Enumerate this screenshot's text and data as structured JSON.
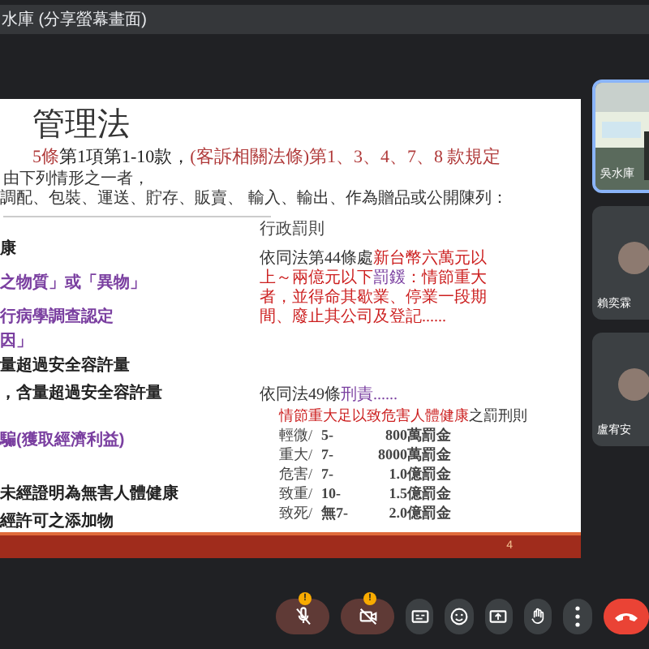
{
  "share_banner": {
    "title": "水庫 (分享螢幕畫面)"
  },
  "slide": {
    "title": "管理法",
    "subtitle": [
      {
        "text": "5條",
        "color": "#b03a3a"
      },
      {
        "text": "第1項第1-10款，",
        "color": "#222222"
      },
      {
        "text": "(客訴相關法條)第1、3、4、7、8 款規定",
        "color": "#b03a3a"
      }
    ],
    "intro_lines": [
      "由下列情形之一者，",
      "調配、包裝、運送、貯存、販賣、 輸入、輸出、作為贈品或公開陳列："
    ],
    "left_items": [
      {
        "text": "康",
        "color": "#222222"
      },
      {
        "text": "之物質」或「異物」",
        "color": "#7a3fa0"
      },
      {
        "text": "行病學調查認定",
        "color": "#7a3fa0"
      },
      {
        "text": "因」",
        "color": "#7a3fa0"
      },
      {
        "text": "量超過安全容許量",
        "color": "#222222"
      },
      {
        "text": "，含量超過安全容許量",
        "color": "#222222"
      },
      {
        "text": "騙(獲取經濟利益)",
        "color": "#7a3fa0"
      },
      {
        "text": "未經證明為無害人體健康",
        "color": "#222222"
      },
      {
        "text": "經許可之添加物",
        "color": "#222222"
      }
    ],
    "admin_heading": "行政罰則",
    "admin_text": [
      {
        "text": "依同法第44條處",
        "color": "#333333"
      },
      {
        "text": "新台幣六萬元以上～兩億元以下",
        "color": "#cc1f1f"
      },
      {
        "text": "罰鍰",
        "color": "#7a3fa0"
      },
      {
        "text": "：情節重大者，並得命其歇業、停業一段期間、廢止其公司及登記......",
        "color": "#cc1f1f"
      }
    ],
    "criminal_heading": [
      {
        "text": "依同法49條",
        "color": "#333333"
      },
      {
        "text": "刑責......",
        "color": "#7a3fa0"
      }
    ],
    "criminal_subheading": [
      {
        "text": "情節重大足以致危害人體健康",
        "color": "#cc1f1f"
      },
      {
        "text": "之罰刑則",
        "color": "#333333"
      }
    ],
    "penalty_rows": [
      {
        "severity": "輕微/",
        "years": "5-",
        "fine": "800萬罰金"
      },
      {
        "severity": "重大/",
        "years": "7-",
        "fine": "8000萬罰金"
      },
      {
        "severity": "危害/",
        "years": "7-",
        "fine": "1.0億罰金"
      },
      {
        "severity": "致重/",
        "years": "10-",
        "fine": "1.5億罰金"
      },
      {
        "severity": "致死/",
        "years": "無7-",
        "fine": "2.0億罰金"
      }
    ],
    "page_number": "4"
  },
  "participants": [
    {
      "kind": "video",
      "name": "吳水庫",
      "selected": true
    },
    {
      "kind": "avatar",
      "name": "賴奕霖",
      "selected": false
    },
    {
      "kind": "avatar",
      "name": "盧宥安",
      "selected": false
    }
  ],
  "controls": [
    {
      "kind": "mic",
      "badge": "!",
      "muted": true
    },
    {
      "kind": "camera",
      "badge": "!",
      "muted": true
    },
    {
      "kind": "captions"
    },
    {
      "kind": "emoji"
    },
    {
      "kind": "present"
    },
    {
      "kind": "hand"
    },
    {
      "kind": "more"
    },
    {
      "kind": "end"
    }
  ]
}
